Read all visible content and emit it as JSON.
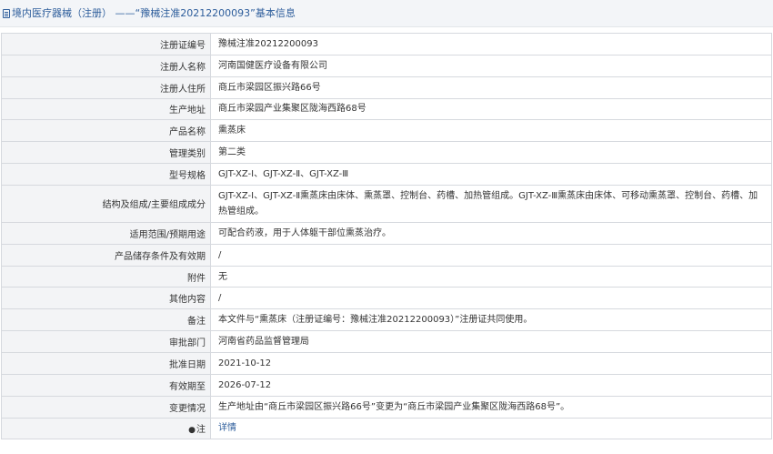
{
  "header": {
    "title": "境内医疗器械（注册）  ——“豫械注准20212200093”基本信息"
  },
  "rows": [
    {
      "label": "注册证编号",
      "value": "豫械注准20212200093"
    },
    {
      "label": "注册人名称",
      "value": "河南国健医疗设备有限公司"
    },
    {
      "label": "注册人住所",
      "value": "商丘市梁园区振兴路66号"
    },
    {
      "label": "生产地址",
      "value": "商丘市梁园产业集聚区陇海西路68号"
    },
    {
      "label": "产品名称",
      "value": "熏蒸床"
    },
    {
      "label": "管理类别",
      "value": "第二类"
    },
    {
      "label": "型号规格",
      "value": "GJT-XZ-Ⅰ、GJT-XZ-Ⅱ、GJT-XZ-Ⅲ"
    },
    {
      "label": "结构及组成/主要组成成分",
      "value": "GJT-XZ-Ⅰ、GJT-XZ-Ⅱ熏蒸床由床体、熏蒸罩、控制台、药槽、加热管组成。GJT-XZ-Ⅲ熏蒸床由床体、可移动熏蒸罩、控制台、药槽、加热管组成。"
    },
    {
      "label": "适用范围/预期用途",
      "value": "可配合药液，用于人体躯干部位熏蒸治疗。"
    },
    {
      "label": "产品储存条件及有效期",
      "value": "/"
    },
    {
      "label": "附件",
      "value": "无"
    },
    {
      "label": "其他内容",
      "value": "/"
    },
    {
      "label": "备注",
      "value": "本文件与“熏蒸床（注册证编号：豫械注准20212200093）”注册证共同使用。"
    },
    {
      "label": "审批部门",
      "value": "河南省药品监督管理局"
    },
    {
      "label": "批准日期",
      "value": "2021-10-12"
    },
    {
      "label": "有效期至",
      "value": "2026-07-12"
    },
    {
      "label": "变更情况",
      "value": "生产地址由“商丘市梁园区振兴路66号”变更为“商丘市梁园产业集聚区陇海西路68号”。"
    },
    {
      "label": "注",
      "value": "详情"
    }
  ],
  "icons": {
    "header": "document-icon",
    "note": "pin-icon"
  },
  "colors": {
    "accent": "#2d5d9b",
    "label_bg": "#f3f4f6",
    "header_bg": "#f3f5f8",
    "border": "#d6d9de"
  }
}
